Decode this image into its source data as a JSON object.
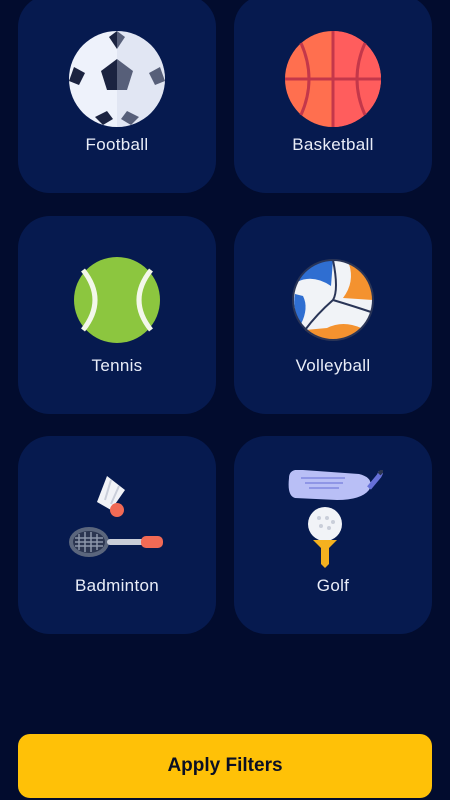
{
  "sports": [
    {
      "label": "Football",
      "icon": "football-icon"
    },
    {
      "label": "Basketball",
      "icon": "basketball-icon"
    },
    {
      "label": "Tennis",
      "icon": "tennis-ball-icon"
    },
    {
      "label": "Volleyball",
      "icon": "volleyball-icon"
    },
    {
      "label": "Badminton",
      "icon": "badminton-icon"
    },
    {
      "label": "Golf",
      "icon": "golf-icon"
    }
  ],
  "apply_button": {
    "label": "Apply Filters",
    "color": "#ffc107"
  },
  "colors": {
    "background": "#020c2e",
    "card": "#061a4f",
    "text": "#e9edf8"
  }
}
